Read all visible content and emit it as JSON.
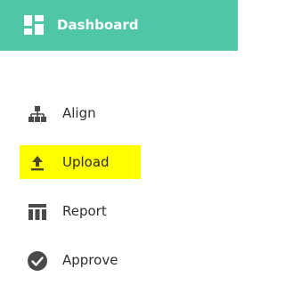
{
  "header": {
    "title": "Dashboard",
    "icon": "dashboard-icon",
    "background_color": "#4fc6a6"
  },
  "nav": {
    "items": [
      {
        "label": "Align",
        "icon": "align-icon",
        "active": false
      },
      {
        "label": "Upload",
        "icon": "upload-icon",
        "active": true
      },
      {
        "label": "Report",
        "icon": "report-icon",
        "active": false
      },
      {
        "label": "Approve",
        "icon": "approve-icon",
        "active": false
      }
    ],
    "active_highlight_color": "#ffff00",
    "icon_color": "#4a4a4a"
  }
}
